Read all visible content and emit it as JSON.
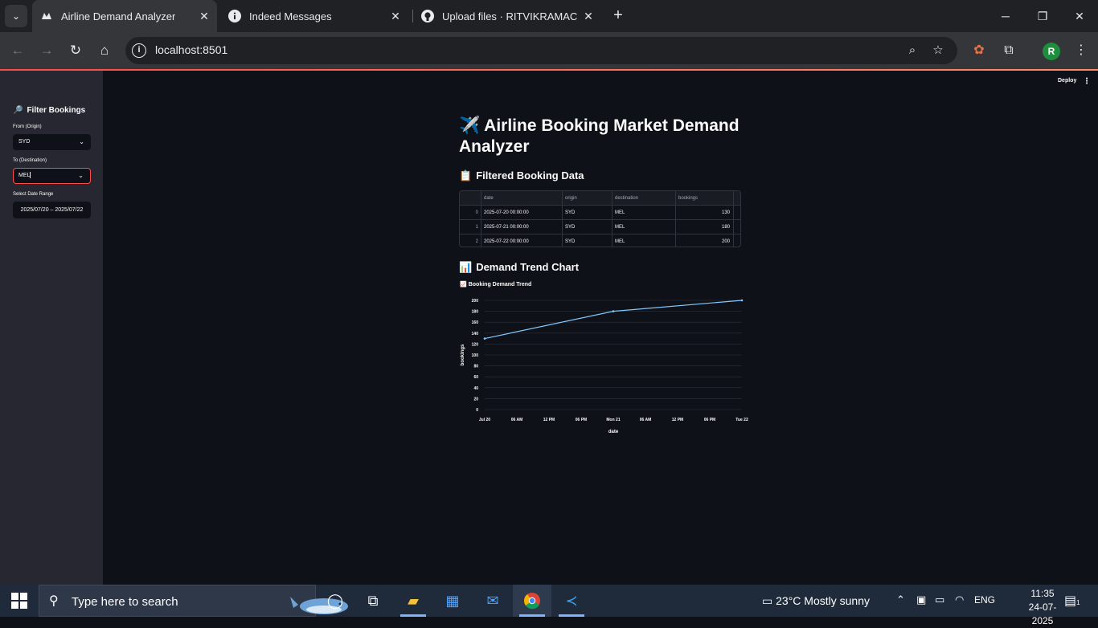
{
  "browser": {
    "tabs": [
      {
        "label": "Airline Demand Analyzer",
        "active": true,
        "icon": "streamlit-icon"
      },
      {
        "label": "Indeed Messages",
        "active": false,
        "icon": "info-icon"
      },
      {
        "label": "Upload files · RITVIKRAMACHAN",
        "active": false,
        "icon": "github-icon"
      }
    ],
    "url": "localhost:8501"
  },
  "app": {
    "deploy_label": "Deploy",
    "sidebar": {
      "title": "Filter Bookings",
      "title_icon": "magnifier-emoji",
      "origin_label": "From (Origin)",
      "origin_value": "SYD",
      "destination_label": "To (Destination)",
      "destination_value": "MEL",
      "date_label": "Select Date Range",
      "date_value": "2025/07/20 – 2025/07/22"
    },
    "title": "Airline Booking Market Demand Analyzer",
    "title_icon": "airplane-emoji",
    "table_heading": "Filtered Booking Data",
    "table_heading_icon": "clipboard-emoji",
    "table": {
      "columns": [
        "",
        "date",
        "origin",
        "destination",
        "bookings"
      ],
      "rows": [
        [
          "0",
          "2025-07-20 00:00:00",
          "SYD",
          "MEL",
          "130"
        ],
        [
          "1",
          "2025-07-21 00:00:00",
          "SYD",
          "MEL",
          "180"
        ],
        [
          "2",
          "2025-07-22 00:00:00",
          "SYD",
          "MEL",
          "200"
        ]
      ]
    },
    "chart_heading": "Demand Trend Chart",
    "chart_heading_icon": "bar-chart-emoji",
    "chart_subtitle": "Booking Demand Trend",
    "chart_subtitle_icon": "line-chart-emoji"
  },
  "chart_data": {
    "type": "line",
    "title": "Booking Demand Trend",
    "xlabel": "date",
    "ylabel": "bookings",
    "x": [
      "2025-07-20 00:00",
      "2025-07-21 00:00",
      "2025-07-22 00:00"
    ],
    "values": [
      130,
      180,
      200
    ],
    "ylim": [
      0,
      200
    ],
    "yticks": [
      "0",
      "20",
      "40",
      "60",
      "80",
      "100",
      "120",
      "140",
      "160",
      "180",
      "200"
    ],
    "xticks": [
      "Jul 20",
      "06 AM",
      "12 PM",
      "06 PM",
      "Mon 21",
      "06 AM",
      "12 PM",
      "06 PM",
      "Tue 22"
    ],
    "grid": true,
    "line_color": "#83c9ff"
  },
  "taskbar": {
    "search_placeholder": "Type here to search",
    "weather": "23°C  Mostly sunny",
    "language": "ENG",
    "time": "11:35",
    "date": "24-07-2025",
    "notification_count": "1"
  }
}
